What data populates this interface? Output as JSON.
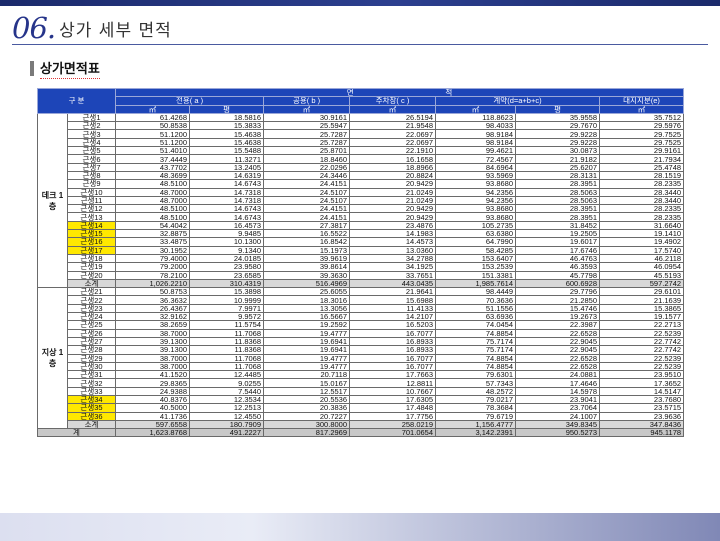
{
  "header": {
    "number": "06.",
    "title": "상가 세부 면적"
  },
  "section": {
    "title": "상가면적표"
  },
  "table": {
    "head": {
      "top_group": "면                                            적",
      "gubun": "구  분",
      "columns": [
        "전용( a )",
        "공용( b )",
        "주차장( c )",
        "계약(d=a+b+c)",
        "대지지분(e)"
      ],
      "units": [
        "㎡",
        "평",
        "㎡",
        "㎡",
        "㎡",
        "평",
        "㎡"
      ]
    },
    "groups": [
      {
        "floor": "데크 1층",
        "rows": [
          {
            "name": "근생1",
            "v": [
              "61.4268",
              "18.5816",
              "30.9161",
              "26.5194",
              "118.8623",
              "35.9558",
              "35.7512"
            ]
          },
          {
            "name": "근생2",
            "v": [
              "50.8538",
              "15.3833",
              "25.5947",
              "21.9548",
              "98.4033",
              "29.7670",
              "29.5976"
            ]
          },
          {
            "name": "근생3",
            "v": [
              "51.1200",
              "15.4638",
              "25.7287",
              "22.0697",
              "98.9184",
              "29.9228",
              "29.7525"
            ]
          },
          {
            "name": "근생4",
            "v": [
              "51.1200",
              "15.4638",
              "25.7287",
              "22.0697",
              "98.9184",
              "29.9228",
              "29.7525"
            ]
          },
          {
            "name": "근생5",
            "v": [
              "51.4010",
              "15.5488",
              "25.8701",
              "22.1910",
              "99.4621",
              "30.0873",
              "29.9161"
            ]
          },
          {
            "name": "근생6",
            "v": [
              "37.4449",
              "11.3271",
              "18.8460",
              "16.1658",
              "72.4567",
              "21.9182",
              "21.7934"
            ]
          },
          {
            "name": "근생7",
            "v": [
              "43.7702",
              "13.2405",
              "22.0296",
              "18.8966",
              "84.6964",
              "25.6207",
              "25.4748"
            ]
          },
          {
            "name": "근생8",
            "v": [
              "48.3699",
              "14.6319",
              "24.3446",
              "20.8824",
              "93.5969",
              "28.3131",
              "28.1519"
            ]
          },
          {
            "name": "근생9",
            "v": [
              "48.5100",
              "14.6743",
              "24.4151",
              "20.9429",
              "93.8680",
              "28.3951",
              "28.2335"
            ]
          },
          {
            "name": "근생10",
            "v": [
              "48.7000",
              "14.7318",
              "24.5107",
              "21.0249",
              "94.2356",
              "28.5063",
              "28.3440"
            ]
          },
          {
            "name": "근생11",
            "v": [
              "48.7000",
              "14.7318",
              "24.5107",
              "21.0249",
              "94.2356",
              "28.5063",
              "28.3440"
            ]
          },
          {
            "name": "근생12",
            "v": [
              "48.5100",
              "14.6743",
              "24.4151",
              "20.9429",
              "93.8680",
              "28.3951",
              "28.2335"
            ]
          },
          {
            "name": "근생13",
            "v": [
              "48.5100",
              "14.6743",
              "24.4151",
              "20.9429",
              "93.8680",
              "28.3951",
              "28.2335"
            ]
          },
          {
            "name": "근생14",
            "hl": true,
            "v": [
              "54.4042",
              "16.4573",
              "27.3817",
              "23.4876",
              "105.2735",
              "31.8452",
              "31.6640"
            ]
          },
          {
            "name": "근생15",
            "hl": true,
            "v": [
              "32.8875",
              "9.9485",
              "16.5522",
              "14.1983",
              "63.6380",
              "19.2505",
              "19.1410"
            ]
          },
          {
            "name": "근생16",
            "hl": true,
            "v": [
              "33.4875",
              "10.1300",
              "16.8542",
              "14.4573",
              "64.7990",
              "19.6017",
              "19.4902"
            ]
          },
          {
            "name": "근생17",
            "hl": true,
            "v": [
              "30.1952",
              "9.1340",
              "15.1973",
              "13.0360",
              "58.4285",
              "17.6746",
              "17.5740"
            ]
          },
          {
            "name": "근생18",
            "v": [
              "79.4000",
              "24.0185",
              "39.9619",
              "34.2788",
              "153.6407",
              "46.4763",
              "46.2118"
            ]
          },
          {
            "name": "근생19",
            "v": [
              "79.2000",
              "23.9580",
              "39.8614",
              "34.1925",
              "153.2539",
              "46.3593",
              "46.0954"
            ]
          },
          {
            "name": "근생20",
            "v": [
              "78.2100",
              "23.6585",
              "39.3630",
              "33.7651",
              "151.3381",
              "45.7798",
              "45.5193"
            ]
          }
        ],
        "subtotal": {
          "name": "소계",
          "v": [
            "1,026.2210",
            "310.4319",
            "516.4969",
            "443.0435",
            "1,985.7614",
            "600.6928",
            "597.2742"
          ]
        }
      },
      {
        "floor": "지상 1층",
        "rows": [
          {
            "name": "근생21",
            "v": [
              "50.8753",
              "15.3898",
              "25.6055",
              "21.9641",
              "98.4449",
              "29.7796",
              "29.6101"
            ]
          },
          {
            "name": "근생22",
            "v": [
              "36.3632",
              "10.9999",
              "18.3016",
              "15.6988",
              "70.3636",
              "21.2850",
              "21.1639"
            ]
          },
          {
            "name": "근생23",
            "v": [
              "26.4367",
              "7.9971",
              "13.3056",
              "11.4133",
              "51.1556",
              "15.4746",
              "15.3865"
            ]
          },
          {
            "name": "근생24",
            "v": [
              "32.9162",
              "9.9572",
              "16.5667",
              "14.2107",
              "63.6936",
              "19.2673",
              "19.1577"
            ]
          },
          {
            "name": "근생25",
            "v": [
              "38.2659",
              "11.5754",
              "19.2592",
              "16.5203",
              "74.0454",
              "22.3987",
              "22.2713"
            ]
          },
          {
            "name": "근생26",
            "v": [
              "38.7000",
              "11.7068",
              "19.4777",
              "16.7077",
              "74.8854",
              "22.6528",
              "22.5239"
            ]
          },
          {
            "name": "근생27",
            "v": [
              "39.1300",
              "11.8368",
              "19.6941",
              "16.8933",
              "75.7174",
              "22.9045",
              "22.7742"
            ]
          },
          {
            "name": "근생28",
            "v": [
              "39.1300",
              "11.8368",
              "19.6941",
              "16.8933",
              "75.7174",
              "22.9045",
              "22.7742"
            ]
          },
          {
            "name": "근생29",
            "v": [
              "38.7000",
              "11.7068",
              "19.4777",
              "16.7077",
              "74.8854",
              "22.6528",
              "22.5239"
            ]
          },
          {
            "name": "근생30",
            "v": [
              "38.7000",
              "11.7068",
              "19.4777",
              "16.7077",
              "74.8854",
              "22.6528",
              "22.5239"
            ]
          },
          {
            "name": "근생31",
            "v": [
              "41.1520",
              "12.4485",
              "20.7118",
              "17.7663",
              "79.6301",
              "24.0881",
              "23.9510"
            ]
          },
          {
            "name": "근생32",
            "v": [
              "29.8365",
              "9.0255",
              "15.0167",
              "12.8811",
              "57.7343",
              "17.4646",
              "17.3652"
            ]
          },
          {
            "name": "근생33",
            "v": [
              "24.9388",
              "7.5440",
              "12.5517",
              "10.7667",
              "48.2572",
              "14.5978",
              "14.5147"
            ]
          },
          {
            "name": "근생34",
            "hl": true,
            "v": [
              "40.8376",
              "12.3534",
              "20.5536",
              "17.6305",
              "79.0217",
              "23.9041",
              "23.7680"
            ]
          },
          {
            "name": "근생35",
            "hl": true,
            "v": [
              "40.5000",
              "12.2513",
              "20.3836",
              "17.4848",
              "78.3684",
              "23.7064",
              "23.5715"
            ]
          },
          {
            "name": "근생36",
            "hl": true,
            "v": [
              "41.1736",
              "12.4550",
              "20.7227",
              "17.7756",
              "79.6719",
              "24.1007",
              "23.9636"
            ]
          }
        ],
        "subtotal": {
          "name": "소계",
          "v": [
            "597.6558",
            "180.7909",
            "300.8000",
            "258.0219",
            "1,156.4777",
            "349.8345",
            "347.8436"
          ]
        }
      }
    ],
    "total": {
      "name": "계",
      "v": [
        "1,623.8768",
        "491.2227",
        "817.2969",
        "701.0654",
        "3,142.2391",
        "950.5273",
        "945.1178"
      ]
    }
  }
}
